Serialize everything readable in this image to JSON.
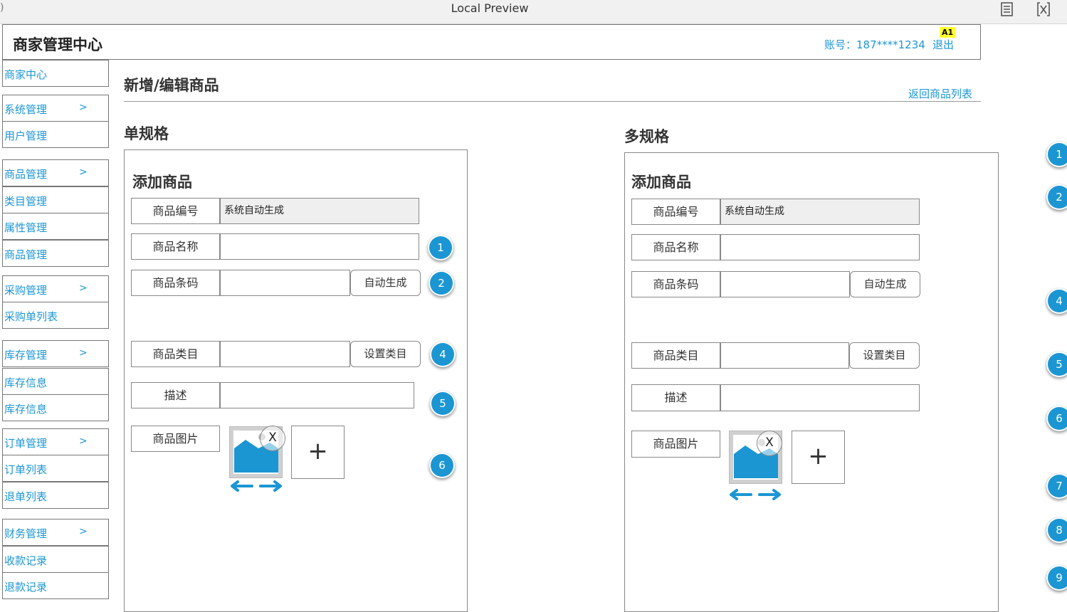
{
  "window": {
    "title": "Local Preview"
  },
  "header": {
    "brand": "商家管理中心",
    "account": "账号：187****1234",
    "logout": "退出",
    "badge": "A1"
  },
  "sidebar": {
    "items": [
      {
        "label": "商家中心",
        "arrow": ""
      },
      {
        "label": "系统管理",
        "arrow": ">"
      },
      {
        "label": "用户管理",
        "arrow": ""
      },
      {
        "label": "商品管理",
        "arrow": ">"
      },
      {
        "label": "类目管理",
        "arrow": ""
      },
      {
        "label": "属性管理",
        "arrow": ""
      },
      {
        "label": "商品管理",
        "arrow": ""
      },
      {
        "label": "采购管理",
        "arrow": ">"
      },
      {
        "label": "采购单列表",
        "arrow": ""
      },
      {
        "label": "库存管理",
        "arrow": ">"
      },
      {
        "label": "库存信息",
        "arrow": ""
      },
      {
        "label": "库存信息",
        "arrow": ""
      },
      {
        "label": "订单管理",
        "arrow": ">"
      },
      {
        "label": "订单列表",
        "arrow": ""
      },
      {
        "label": "退单列表",
        "arrow": ""
      },
      {
        "label": "财务管理",
        "arrow": ">"
      },
      {
        "label": "收款记录",
        "arrow": ""
      },
      {
        "label": "退款记录",
        "arrow": ""
      }
    ]
  },
  "page": {
    "title": "新增/编辑商品",
    "back_link": "返回商品列表"
  },
  "single": {
    "section_title": "单规格",
    "panel_title": "添加商品",
    "code_label": "商品编号",
    "code_value": "系统自动生成",
    "name_label": "商品名称",
    "name_value": "",
    "barcode_label": "商品条码",
    "barcode_value": "",
    "auto_btn": "自动生成",
    "category_label": "商品类目",
    "category_value": "",
    "category_btn": "设置类目",
    "desc_label": "描述",
    "desc_value": "",
    "image_label": "商品图片",
    "remove_label": "X",
    "add_label": "+"
  },
  "multi": {
    "section_title": "多规格",
    "panel_title": "添加商品",
    "code_label": "商品编号",
    "code_value": "系统自动生成",
    "name_label": "商品名称",
    "name_value": "",
    "barcode_label": "商品条码",
    "barcode_value": "",
    "auto_btn": "自动生成",
    "category_label": "商品类目",
    "category_value": "",
    "category_btn": "设置类目",
    "desc_label": "描述",
    "desc_value": "",
    "image_label": "商品图片",
    "remove_label": "X",
    "add_label": "+"
  },
  "markers": {
    "single": [
      "1",
      "2",
      "4",
      "5",
      "6"
    ],
    "right": [
      "1",
      "2",
      "4",
      "5",
      "6",
      "7",
      "8",
      "9"
    ]
  },
  "colors": {
    "accent": "#1c96d3",
    "marker": "#1b96d3",
    "badge": "#ffff2e",
    "readonly_bg": "#efefef"
  }
}
